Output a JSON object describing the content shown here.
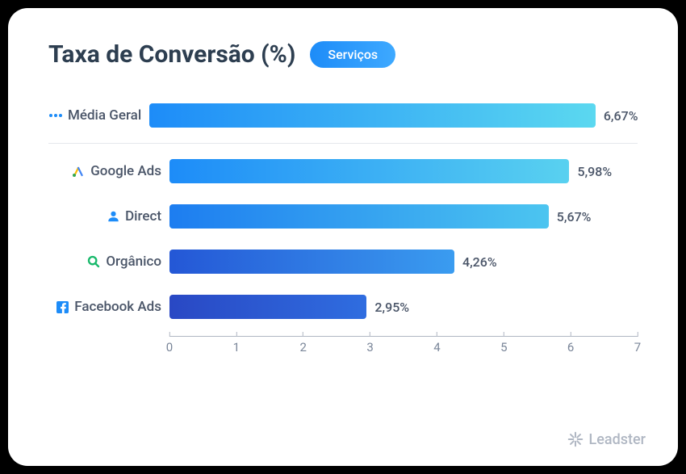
{
  "title": "Taxa de Conversão (%)",
  "badge": "Serviços",
  "brand": "Leadster",
  "chart_data": {
    "type": "bar",
    "title": "Taxa de Conversão (%)",
    "xlabel": "",
    "ylabel": "",
    "xlim": [
      0,
      7
    ],
    "ticks": [
      0,
      1,
      2,
      3,
      4,
      5,
      6,
      7
    ],
    "categories": [
      "Média Geral",
      "Google Ads",
      "Direct",
      "Orgânico",
      "Facebook Ads"
    ],
    "values": [
      6.67,
      5.98,
      5.67,
      4.26,
      2.95
    ],
    "separator_after_index": 0,
    "rows": [
      {
        "label": "Média Geral",
        "value": 6.67,
        "value_label": "6,67%",
        "icon": "dots-icon",
        "gradient": [
          "#1d8cf8",
          "#5bd8f0"
        ]
      },
      {
        "label": "Google Ads",
        "value": 5.98,
        "value_label": "5,98%",
        "icon": "google-ads-icon",
        "gradient": [
          "#1d8cf8",
          "#59d1f0"
        ]
      },
      {
        "label": "Direct",
        "value": 5.67,
        "value_label": "5,67%",
        "icon": "person-icon",
        "gradient": [
          "#1d7df0",
          "#4cc5f0"
        ]
      },
      {
        "label": "Orgânico",
        "value": 4.26,
        "value_label": "4,26%",
        "icon": "search-icon",
        "gradient": [
          "#2457d6",
          "#3a9cf0"
        ]
      },
      {
        "label": "Facebook Ads",
        "value": 2.95,
        "value_label": "2,95%",
        "icon": "facebook-icon",
        "gradient": [
          "#2948c4",
          "#2f6de0"
        ]
      }
    ]
  }
}
